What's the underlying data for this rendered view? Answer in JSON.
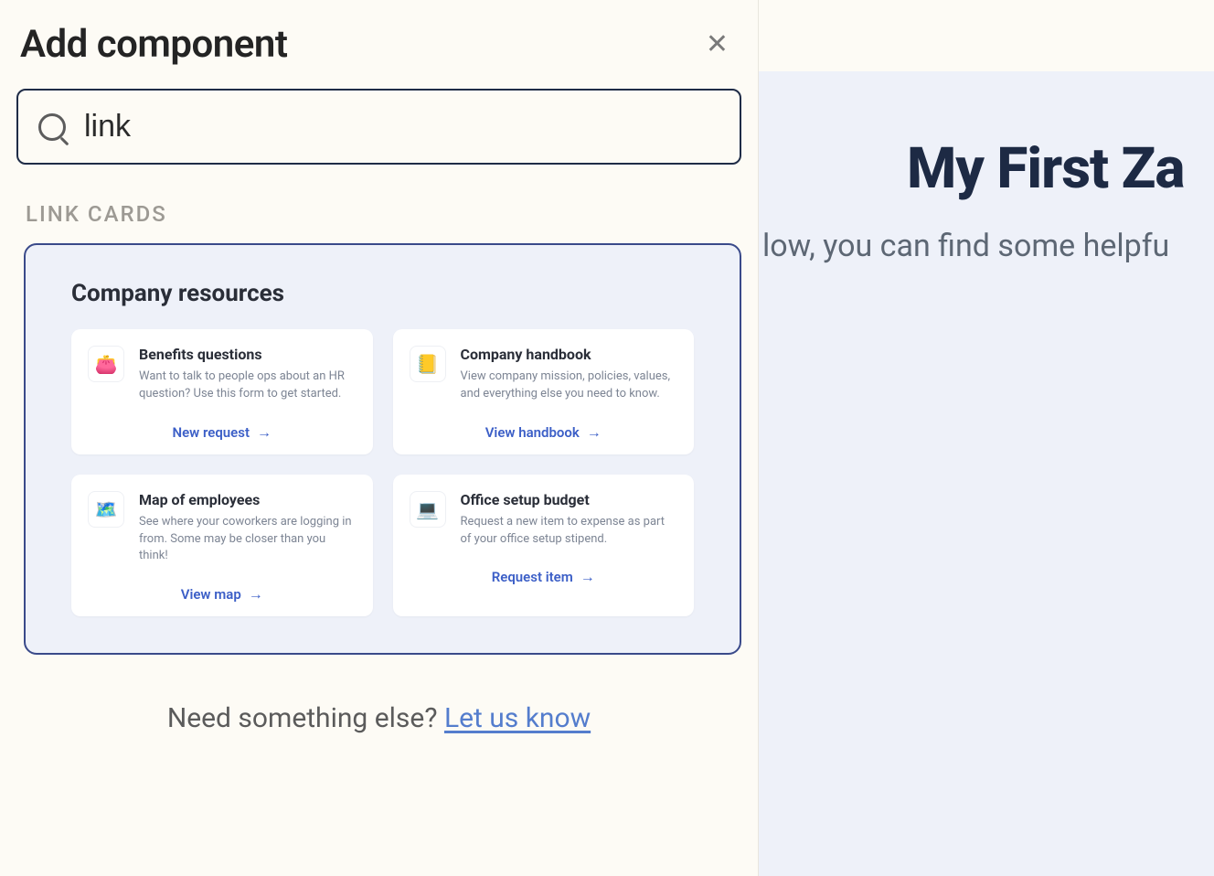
{
  "panel": {
    "title": "Add component",
    "search_value": "link",
    "section_label": "LINK CARDS",
    "result_title": "Company resources",
    "cards": [
      {
        "icon": "👛",
        "title": "Benefits questions",
        "desc": "Want to talk to people ops about an HR question? Use this form to get started.",
        "cta": "New request"
      },
      {
        "icon": "📒",
        "title": "Company handbook",
        "desc": "View company mission, policies, values, and everything else you need to know.",
        "cta": "View handbook"
      },
      {
        "icon": "🗺️",
        "title": "Map of employees",
        "desc": "See where your coworkers are logging in from. Some may be closer than you think!",
        "cta": "View map"
      },
      {
        "icon": "💻",
        "title": "Office setup budget",
        "desc": "Request a new item to expense as part of your office setup stipend.",
        "cta": "Request item"
      }
    ],
    "footer_text": "Need something else? ",
    "footer_link": "Let us know"
  },
  "preview": {
    "title": "My First Za",
    "subtitle": "low, you can find some helpfu"
  }
}
